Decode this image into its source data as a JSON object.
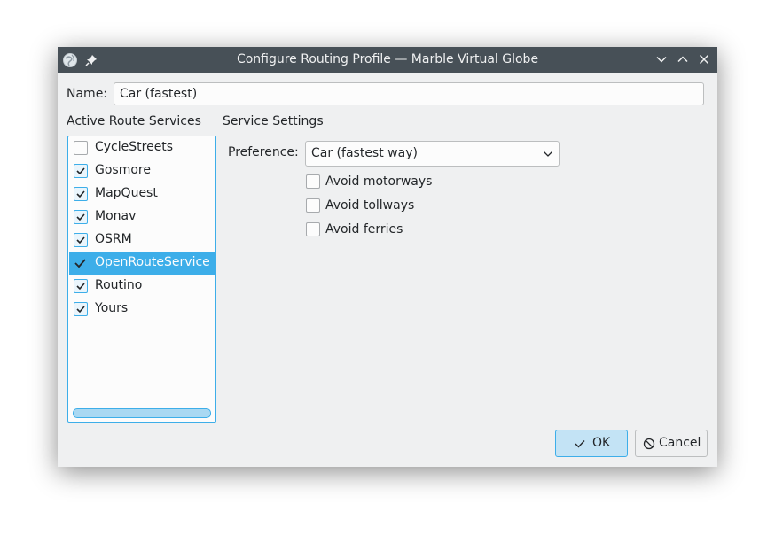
{
  "window": {
    "title": "Configure Routing Profile — Marble Virtual Globe"
  },
  "name": {
    "label": "Name:",
    "value": "Car (fastest)"
  },
  "services": {
    "heading": "Active Route Services",
    "items": [
      {
        "label": "CycleStreets",
        "checked": false
      },
      {
        "label": "Gosmore",
        "checked": true
      },
      {
        "label": "MapQuest",
        "checked": true
      },
      {
        "label": "Monav",
        "checked": true
      },
      {
        "label": "OSRM",
        "checked": true
      },
      {
        "label": "OpenRouteService",
        "checked": true,
        "selected": true
      },
      {
        "label": "Routino",
        "checked": true
      },
      {
        "label": "Yours",
        "checked": true
      }
    ]
  },
  "settings": {
    "heading": "Service Settings",
    "preference_label": "Preference:",
    "preference_value": "Car (fastest way)",
    "options": [
      {
        "label": "Avoid motorways",
        "checked": false
      },
      {
        "label": "Avoid tollways",
        "checked": false
      },
      {
        "label": "Avoid ferries",
        "checked": false
      }
    ]
  },
  "buttons": {
    "ok": "OK",
    "cancel": "Cancel"
  },
  "colors": {
    "accent": "#3daee9",
    "titlebar": "#475057",
    "window_bg": "#eff0f1"
  }
}
